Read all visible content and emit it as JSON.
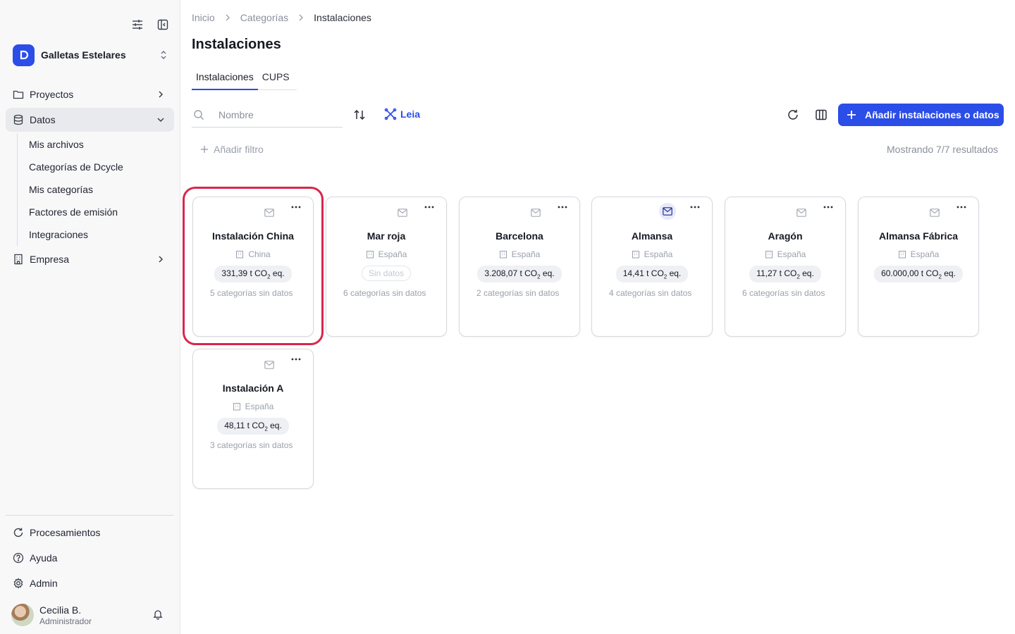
{
  "organization": {
    "name": "Galletas Estelares"
  },
  "sidebar": {
    "items": [
      {
        "label": "Proyectos",
        "icon": "folder-icon"
      },
      {
        "label": "Datos",
        "icon": "database-icon"
      },
      {
        "label": "Empresa",
        "icon": "building-icon"
      }
    ],
    "datos_subitems": [
      "Mis archivos",
      "Categorías de Dcycle",
      "Mis categorías",
      "Factores de emisión",
      "Integraciones"
    ],
    "bottom_items": [
      {
        "label": "Procesamientos",
        "icon": "refresh-icon"
      },
      {
        "label": "Ayuda",
        "icon": "help-icon"
      },
      {
        "label": "Admin",
        "icon": "gear-icon"
      }
    ],
    "user": {
      "name": "Cecilia B.",
      "role": "Administrador"
    }
  },
  "breadcrumb": [
    "Inicio",
    "Categorías",
    "Instalaciones"
  ],
  "page_title": "Instalaciones",
  "tabs": [
    "Instalaciones",
    "CUPS"
  ],
  "toolbar": {
    "search_placeholder": "Nombre",
    "leia_label": "Leia",
    "add_label": "Añadir instalaciones o datos"
  },
  "filters": {
    "add_filter_label": "Añadir filtro",
    "results_text": "Mostrando 7/7 resultados"
  },
  "cards": [
    {
      "name": "Instalación China",
      "location": "China",
      "emissions_value": "331,39 t CO",
      "emissions_unit": " eq.",
      "missing": "5 categorías sin datos",
      "mail_active": false
    },
    {
      "name": "Mar roja",
      "location": "España",
      "emissions_value": "Sin datos",
      "emissions_unit": "",
      "missing": "6 categorías sin datos",
      "mail_active": false
    },
    {
      "name": "Barcelona",
      "location": "España",
      "emissions_value": "3.208,07 t CO",
      "emissions_unit": " eq.",
      "missing": "2 categorías sin datos",
      "mail_active": false
    },
    {
      "name": "Almansa",
      "location": "España",
      "emissions_value": "14,41 t CO",
      "emissions_unit": " eq.",
      "missing": "4 categorías sin datos",
      "mail_active": true
    },
    {
      "name": "Aragón",
      "location": "España",
      "emissions_value": "11,27 t CO",
      "emissions_unit": " eq.",
      "missing": "6 categorías sin datos",
      "mail_active": false
    },
    {
      "name": "Almansa Fábrica",
      "location": "España",
      "emissions_value": "60.000,00 t CO",
      "emissions_unit": " eq.",
      "missing": "",
      "mail_active": false
    },
    {
      "name": "Instalación A",
      "location": "España",
      "emissions_value": "48,11 t CO",
      "emissions_unit": " eq.",
      "missing": "3 categorías sin datos",
      "mail_active": false
    }
  ],
  "colors": {
    "accent": "#2b4de8",
    "highlight": "#d8274c"
  }
}
